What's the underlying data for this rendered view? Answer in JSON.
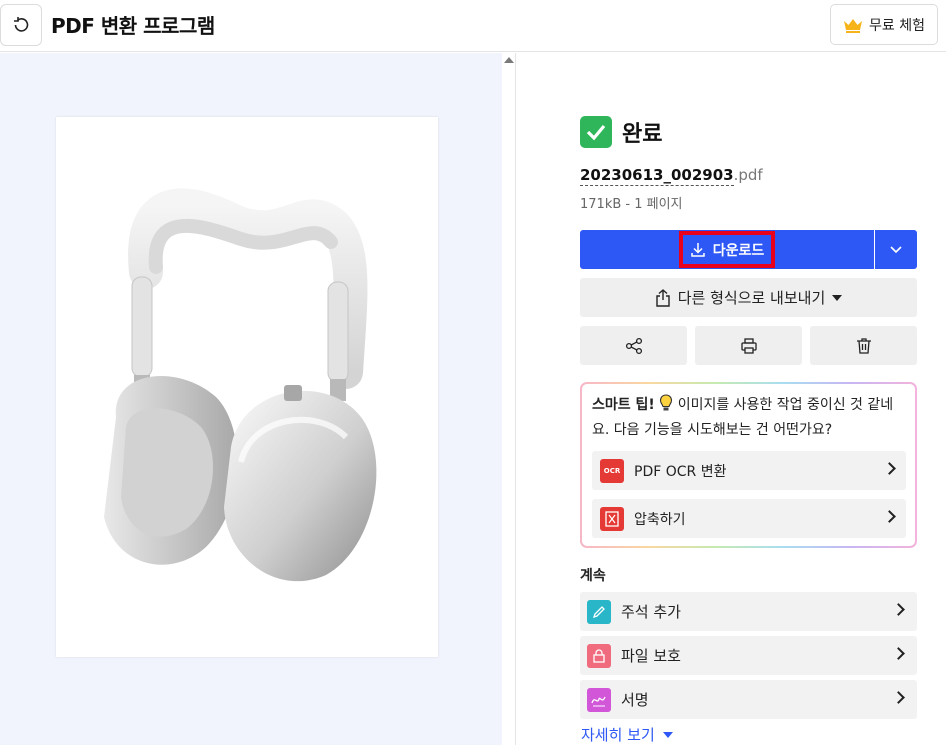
{
  "header": {
    "title": "PDF 변환 프로그램",
    "trial_label": "무료 체험"
  },
  "result": {
    "status": "완료",
    "file_base": "20230613_002903",
    "file_ext": ".pdf",
    "file_meta": "171kB - 1 페이지",
    "download_label": "다운로드",
    "export_label": "다른 형식으로 내보내기"
  },
  "tip": {
    "title": "스마트 팁!",
    "text": "이미지를 사용한 작업 중이신 것 같네요. 다음 기능을 시도해보는 건 어떤가요?",
    "items": [
      {
        "label": "PDF OCR 변환",
        "badge": "OCR"
      },
      {
        "label": "압축하기"
      }
    ]
  },
  "continue": {
    "title": "계속",
    "items": [
      {
        "label": "주석 추가"
      },
      {
        "label": "파일 보호"
      },
      {
        "label": "서명"
      }
    ],
    "more_label": "자세히 보기"
  },
  "colors": {
    "primary": "#2d58f5",
    "success": "#2fb55a",
    "highlight": "#e8001c",
    "preview_bg": "#f1f4fd",
    "ocr_badge": "#e53935",
    "annotate_badge": "#29b6c8",
    "protect_badge": "#f06b7e",
    "sign_badge": "#d156d8"
  },
  "icons": [
    "undo-icon",
    "crown-icon",
    "check-icon",
    "download-icon",
    "chevron-down-icon",
    "share-upload-icon",
    "share-icon",
    "print-icon",
    "trash-icon",
    "lightbulb-icon",
    "ocr-icon",
    "compress-icon",
    "pencil-icon",
    "lock-icon",
    "signature-icon",
    "chevron-right-icon"
  ]
}
